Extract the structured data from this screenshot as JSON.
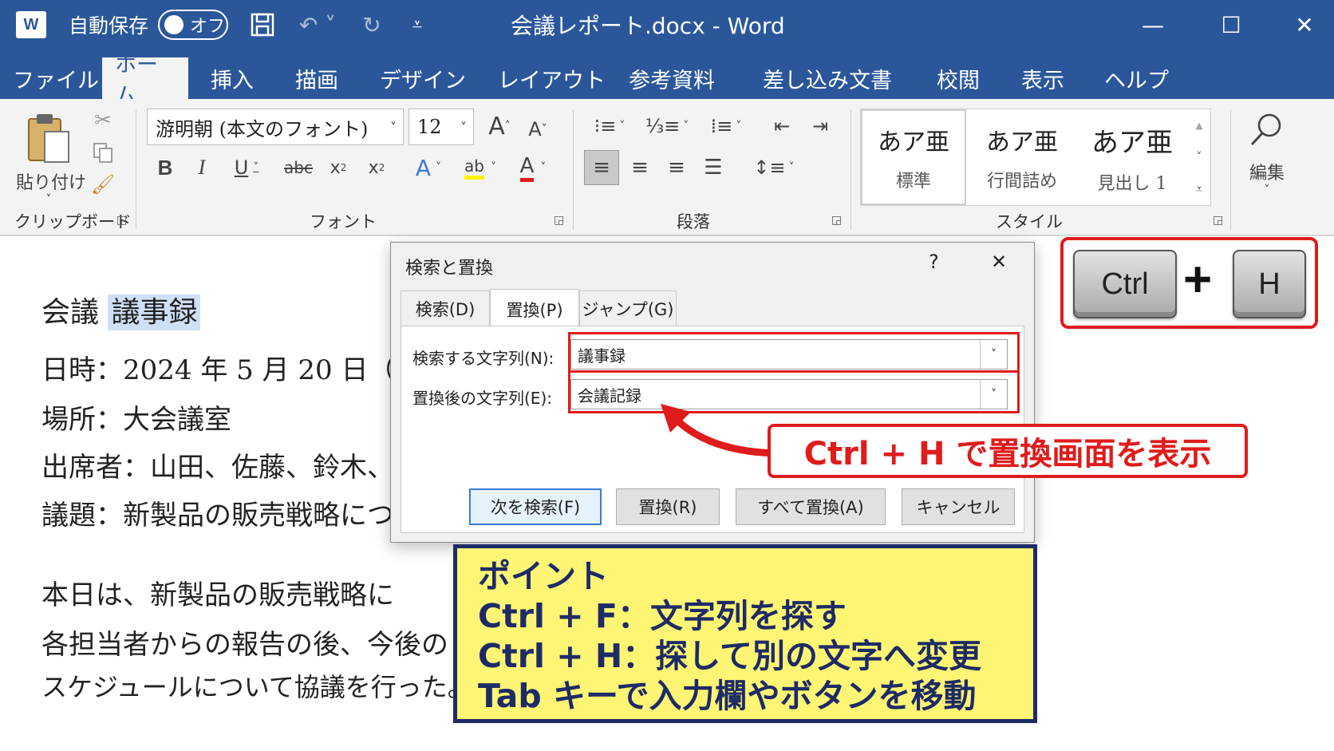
{
  "titlebar": {
    "autosave_label": "自動保存",
    "autosave_state": "オフ",
    "document_title": "会議レポート.docx  -  Word"
  },
  "ribbon_tabs": [
    "ファイル",
    "ホーム",
    "挿入",
    "描画",
    "デザイン",
    "レイアウト",
    "参考資料",
    "差し込み文書",
    "校閲",
    "表示",
    "ヘルプ"
  ],
  "ribbon": {
    "clipboard": {
      "paste_label": "貼り付け",
      "group_label": "クリップボード"
    },
    "font": {
      "font_name": "游明朝 (本文のフォント)",
      "font_size": "12",
      "group_label": "フォント"
    },
    "paragraph": {
      "group_label": "段落"
    },
    "styles": {
      "group_label": "スタイル",
      "items": [
        {
          "preview": "あア亜",
          "name": "標準"
        },
        {
          "preview": "あア亜",
          "name": "行間詰め"
        },
        {
          "preview": "あア亜",
          "name": "見出し 1"
        }
      ]
    },
    "editing": {
      "label": "編集"
    }
  },
  "document": {
    "title_prefix": "会議 ",
    "title_highlight": "議事録",
    "lines": [
      "日時：2024 年 5 月 20 日（",
      "場所：大会議室",
      "出席者：山田、佐藤、鈴木、",
      "議題：新製品の販売戦略につ",
      "本日は、新製品の販売戦略に",
      "各担当者からの報告の後、今後の",
      "スケジュールについて協議を行った。"
    ]
  },
  "dialog": {
    "title": "検索と置換",
    "help": "?",
    "close": "✕",
    "tabs": [
      "検索(D)",
      "置換(P)",
      "ジャンプ(G)"
    ],
    "active_tab": "置換(P)",
    "find_label": "検索する文字列(N):",
    "find_value": "議事録",
    "replace_label": "置換後の文字列(E):",
    "replace_value": "会議記録",
    "buttons": {
      "find_next": "次を検索(F)",
      "replace": "置換(R)",
      "replace_all": "すべて置換(A)",
      "cancel": "キャンセル"
    }
  },
  "shortcut": {
    "key1": "Ctrl",
    "plus": "+",
    "key2": "H"
  },
  "callout": {
    "text": "Ctrl + H  で置換画面を表示"
  },
  "point": {
    "lines": [
      "ポイント",
      "Ctrl + F：文字列を探す",
      "Ctrl + H：探して別の文字へ変更",
      "Tab キーで入力欄やボタンを移動"
    ]
  },
  "colors": {
    "word_blue": "#2b579a",
    "annotation_red": "#e01b1b",
    "point_yellow": "#fff574",
    "point_navy": "#1d2b66"
  }
}
